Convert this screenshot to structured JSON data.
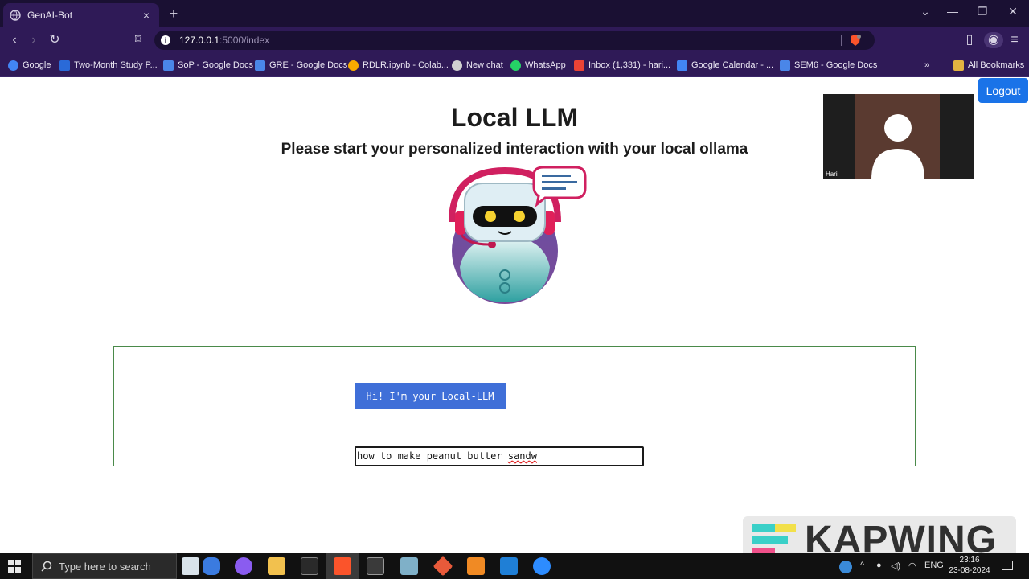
{
  "browser": {
    "tab_title": "GenAI-Bot",
    "tab_close": "×",
    "new_tab": "+",
    "window_controls": {
      "list": "⌄",
      "minimize": "—",
      "restore": "❐",
      "close": "✕"
    },
    "url_host": "127.0.0.1",
    "url_path": ":5000/index",
    "bookmarks": [
      {
        "label": "Google",
        "icon": "google-icon",
        "color": "#4285f4"
      },
      {
        "label": "Two-Month Study P...",
        "icon": "shield-icon",
        "color": "#2a6ad8"
      },
      {
        "label": "SoP - Google Docs",
        "icon": "docs-icon",
        "color": "#4a86e8"
      },
      {
        "label": "GRE - Google Docs",
        "icon": "docs-icon",
        "color": "#4a86e8"
      },
      {
        "label": "RDLR.ipynb - Colab...",
        "icon": "colab-icon",
        "color": "#f9ab00"
      },
      {
        "label": "New chat",
        "icon": "openai-icon",
        "color": "#d0d0d0"
      },
      {
        "label": "WhatsApp",
        "icon": "whatsapp-icon",
        "color": "#25d366"
      },
      {
        "label": "Inbox (1,331) - hari...",
        "icon": "gmail-icon",
        "color": "#ea4335"
      },
      {
        "label": "Google Calendar - ...",
        "icon": "calendar-icon",
        "color": "#4285f4"
      },
      {
        "label": "SEM6 - Google Docs",
        "icon": "docs-icon",
        "color": "#4a86e8"
      }
    ],
    "bookmarks_overflow": "»",
    "all_bookmarks": "All Bookmarks"
  },
  "page": {
    "logout_label": "Logout",
    "title": "Local LLM",
    "subtitle": "Please start your personalized interaction with your local ollama",
    "camera_name": "Hari",
    "chat": {
      "bot_message": "Hi! I'm your Local-LLM",
      "input_value_plain": "how to make peanut butter ",
      "input_value_typo": "sandw"
    },
    "watermark": "KAPWING"
  },
  "taskbar": {
    "search_placeholder": "Type here to search",
    "tray_lang": "ENG",
    "time": "23:16",
    "date": "23-08-2024"
  }
}
